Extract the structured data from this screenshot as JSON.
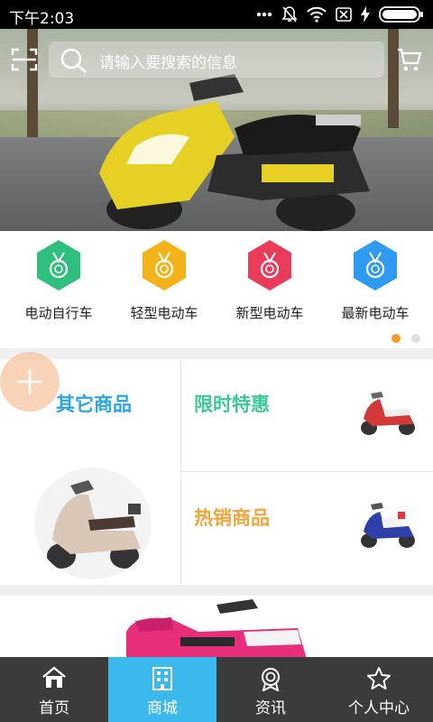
{
  "status_bar": {
    "time": "下午2:03",
    "icons": [
      "dots-icon",
      "mute-icon",
      "wifi-icon",
      "no-sim-icon",
      "charging-icon",
      "battery-icon"
    ]
  },
  "header": {
    "search_placeholder": "请输入要搜索的信息",
    "left_icon": "scan-icon",
    "right_icon": "cart-icon"
  },
  "categories": [
    {
      "label": "电动自行车",
      "color": "#2fbf7d"
    },
    {
      "label": "轻型电动车",
      "color": "#f3b21a"
    },
    {
      "label": "新型电动车",
      "color": "#ea3c5a"
    },
    {
      "label": "最新电动车",
      "color": "#2e9bf0"
    }
  ],
  "pager": {
    "pages": 2,
    "active": 1
  },
  "grid": {
    "left_title": "其它商品",
    "top_right_title": "限时特惠",
    "bottom_right_title": "热销商品",
    "colors": {
      "left": "#2aa5e8",
      "top_right": "#3cc79b",
      "bottom_right": "#f2a53a"
    }
  },
  "fab_icon": "plus-icon",
  "tabs": [
    {
      "label": "首页",
      "icon": "home-icon"
    },
    {
      "label": "商城",
      "icon": "building-icon",
      "active": true
    },
    {
      "label": "资讯",
      "icon": "badge-icon"
    },
    {
      "label": "个人中心",
      "icon": "star-icon"
    }
  ]
}
